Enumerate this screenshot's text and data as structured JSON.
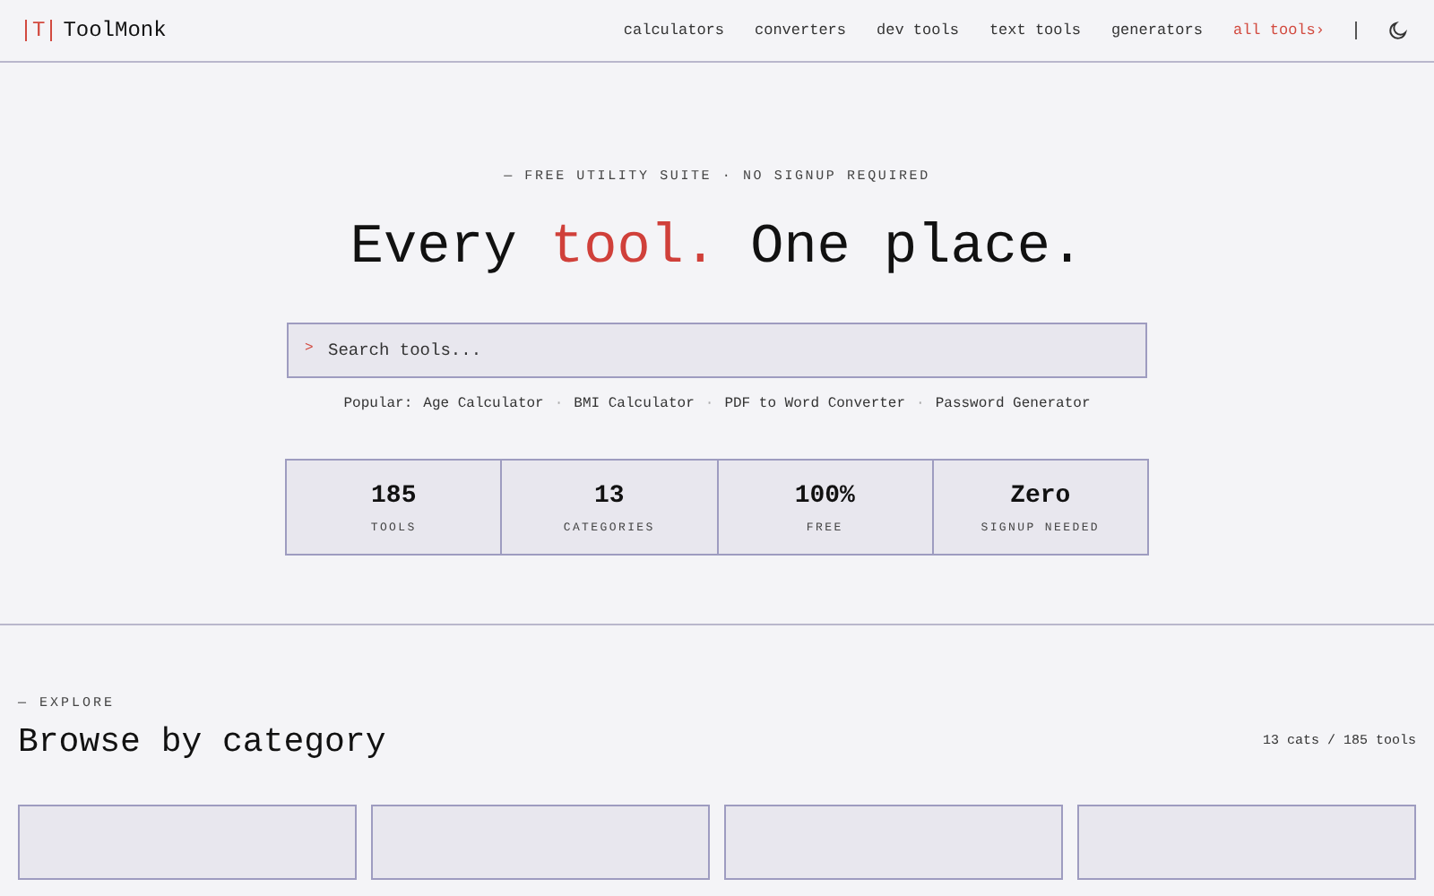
{
  "header": {
    "logo_mark": "T",
    "brand": "ToolMonk",
    "nav": [
      {
        "label": "calculators",
        "selected": false
      },
      {
        "label": "converters",
        "selected": false
      },
      {
        "label": "dev tools",
        "selected": false
      },
      {
        "label": "text tools",
        "selected": false
      },
      {
        "label": "generators",
        "selected": false
      },
      {
        "label": "all tools",
        "selected": true
      }
    ],
    "all_arrow": "›"
  },
  "hero": {
    "eyebrow": "— FREE UTILITY SUITE · NO SIGNUP REQUIRED",
    "title": "Every **tool.** One place.",
    "search": {
      "prompt": ">",
      "placeholder": "Search tools..."
    },
    "popular_label": "Popular:",
    "popular": [
      "Age Calculator",
      "BMI Calculator",
      "PDF to Word Converter",
      "Password Generator"
    ],
    "separator": "·"
  },
  "stats": [
    {
      "value": "185",
      "label": "TOOLS"
    },
    {
      "value": "13",
      "label": "CATEGORIES"
    },
    {
      "value": "100%",
      "label": "FREE"
    },
    {
      "value": "Zero",
      "label": "SIGNUP NEEDED"
    }
  ],
  "explore": {
    "eyebrow": "— EXPLORE",
    "title": "Browse by category",
    "count": "13 cats / 185 tools"
  }
}
